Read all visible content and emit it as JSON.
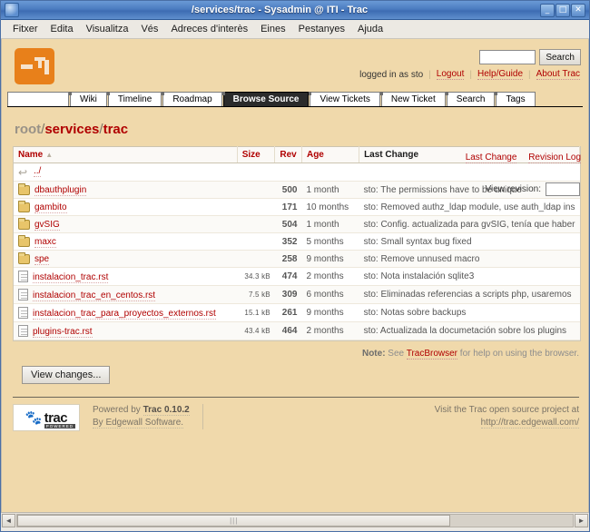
{
  "window": {
    "title": "/services/trac - Sysadmin @ ITI - Trac",
    "icon": "app-icon",
    "minimize": "_",
    "maximize": "□",
    "close": "✕"
  },
  "menubar": {
    "items": [
      {
        "label": "Fitxer"
      },
      {
        "label": "Edita"
      },
      {
        "label": "Visualitza"
      },
      {
        "label": "Vés"
      },
      {
        "label": "Adreces d'interès"
      },
      {
        "label": "Eines"
      },
      {
        "label": "Pestanyes"
      },
      {
        "label": "Ajuda"
      }
    ]
  },
  "banner": {
    "logo_alt": "ITI logo",
    "search": {
      "value": "",
      "placeholder": "",
      "button_label": "Search"
    },
    "metanav": {
      "logged_in": "logged in as sto",
      "logout": "Logout",
      "help_guide": "Help/Guide",
      "about": "About Trac"
    }
  },
  "mainnav": {
    "tabs": [
      {
        "label": "",
        "active": false,
        "spacer": true
      },
      {
        "label": "Wiki",
        "active": false
      },
      {
        "label": "Timeline",
        "active": false
      },
      {
        "label": "Roadmap",
        "active": false
      },
      {
        "label": "Browse Source",
        "active": true
      },
      {
        "label": "View Tickets",
        "active": false
      },
      {
        "label": "New Ticket",
        "active": false
      },
      {
        "label": "Search",
        "active": false
      },
      {
        "label": "Tags",
        "active": false
      }
    ]
  },
  "ctxnav": {
    "last_change": "Last Change",
    "revision_log": "Revision Log"
  },
  "breadcrumb": {
    "root": "root",
    "sep": "/",
    "parts": [
      "services",
      "trac"
    ]
  },
  "revform": {
    "label": "View revision:",
    "value": ""
  },
  "dirlist": {
    "columns": {
      "name": "Name",
      "sort_arrow": "▲",
      "size": "Size",
      "rev": "Rev",
      "age": "Age",
      "last_change": "Last Change"
    },
    "up_entry": "../",
    "rows": [
      {
        "icon": "folder-icon",
        "name": "dbauthplugin",
        "size": "",
        "rev": "500",
        "age": "1 month",
        "change": "sto: The permissions have to be unique"
      },
      {
        "icon": "folder-icon",
        "name": "gambito",
        "size": "",
        "rev": "171",
        "age": "10 months",
        "change": "sto: Removed authz_ldap module, use auth_ldap ins"
      },
      {
        "icon": "folder-icon",
        "name": "gvSIG",
        "size": "",
        "rev": "504",
        "age": "1 month",
        "change": "sto: Config. actualizada para gvSIG, tenía que haber"
      },
      {
        "icon": "folder-icon",
        "name": "maxc",
        "size": "",
        "rev": "352",
        "age": "5 months",
        "change": "sto: Small syntax bug fixed"
      },
      {
        "icon": "folder-icon",
        "name": "spe",
        "size": "",
        "rev": "258",
        "age": "9 months",
        "change": "sto: Remove unnused macro"
      },
      {
        "icon": "file-icon",
        "name": "instalacion_trac.rst",
        "size": "34.3 kB",
        "rev": "474",
        "age": "2 months",
        "change": "sto: Nota instalación sqlite3"
      },
      {
        "icon": "file-icon",
        "name": "instalacion_trac_en_centos.rst",
        "size": "7.5 kB",
        "rev": "309",
        "age": "6 months",
        "change": "sto: Eliminadas referencias a scripts php, usaremos"
      },
      {
        "icon": "file-icon",
        "name": "instalacion_trac_para_proyectos_externos.rst",
        "size": "15.1 kB",
        "rev": "261",
        "age": "9 months",
        "change": "sto: Notas sobre backups"
      },
      {
        "icon": "file-icon",
        "name": "plugins-trac.rst",
        "size": "43.4 kB",
        "rev": "464",
        "age": "2 months",
        "change": "sto: Actualizada la documetación sobre los plugins"
      }
    ]
  },
  "note": {
    "prefix": "Note:",
    "text_before": " See ",
    "link": "TracBrowser",
    "text_after": " for help on using the browser."
  },
  "actions": {
    "view_changes": "View changes..."
  },
  "footer": {
    "badge_word": "trac",
    "badge_powered": "POWERED",
    "powered_by": "Powered by ",
    "trac_version": "Trac 0.10.2",
    "by_line": "By Edgewall Software.",
    "visit_line": "Visit the Trac open source project at",
    "visit_url": "http://trac.edgewall.com/"
  },
  "scrollbar": {
    "left_arrow": "◄",
    "right_arrow": "►",
    "grip": "|||"
  },
  "colors": {
    "page_bg": "#f0d9ab",
    "accent_red": "#b00000",
    "logo_orange": "#e8801a",
    "titlebar_blue": "#4b7cc0"
  }
}
